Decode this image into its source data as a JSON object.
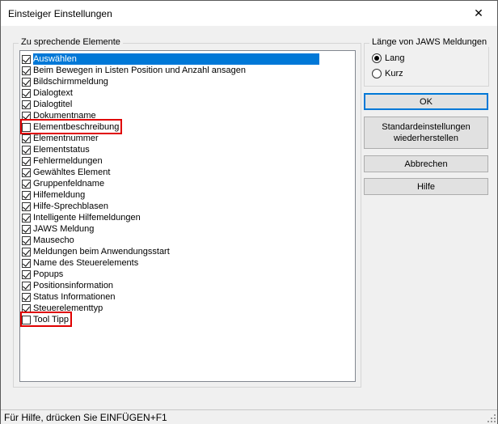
{
  "window": {
    "title": "Einsteiger Einstellungen",
    "close_glyph": "✕"
  },
  "elements_group": {
    "label": "Zu sprechende Elemente",
    "items": [
      {
        "label": "Auswählen",
        "checked": true,
        "selected": true
      },
      {
        "label": "Beim Bewegen in Listen Position und Anzahl ansagen",
        "checked": true
      },
      {
        "label": "Bildschirmmeldung",
        "checked": true
      },
      {
        "label": "Dialogtext",
        "checked": true
      },
      {
        "label": "Dialogtitel",
        "checked": true
      },
      {
        "label": "Dokumentname",
        "checked": true
      },
      {
        "label": "Elementbeschreibung",
        "checked": false,
        "highlighted": true
      },
      {
        "label": "Elementnummer",
        "checked": true
      },
      {
        "label": "Elementstatus",
        "checked": true
      },
      {
        "label": "Fehlermeldungen",
        "checked": true
      },
      {
        "label": "Gewähltes Element",
        "checked": true
      },
      {
        "label": "Gruppenfeldname",
        "checked": true
      },
      {
        "label": "Hilfemeldung",
        "checked": true
      },
      {
        "label": "Hilfe-Sprechblasen",
        "checked": true
      },
      {
        "label": "Intelligente Hilfemeldungen",
        "checked": true
      },
      {
        "label": "JAWS Meldung",
        "checked": true
      },
      {
        "label": "Mausecho",
        "checked": true
      },
      {
        "label": "Meldungen beim Anwendungsstart",
        "checked": true
      },
      {
        "label": "Name des Steuerelements",
        "checked": true
      },
      {
        "label": "Popups",
        "checked": true
      },
      {
        "label": "Positionsinformation",
        "checked": true
      },
      {
        "label": "Status Informationen",
        "checked": true
      },
      {
        "label": "Steuerelementtyp",
        "checked": true
      },
      {
        "label": "Tool Tipp",
        "checked": false,
        "highlighted": true
      }
    ]
  },
  "length_group": {
    "label": "Länge von JAWS Meldungen",
    "options": [
      {
        "label": "Lang",
        "selected": true
      },
      {
        "label": "Kurz",
        "selected": false
      }
    ]
  },
  "buttons": {
    "ok": "OK",
    "restore_line1": "Standardeinstellungen",
    "restore_line2": "wiederherstellen",
    "cancel": "Abbrechen",
    "help": "Hilfe"
  },
  "statusbar": {
    "text": "Für Hilfe, drücken Sie EINFÜGEN+F1"
  },
  "colors": {
    "selection": "#0078d7",
    "highlight_box": "#e00000",
    "default_button_border": "#0078d7"
  }
}
